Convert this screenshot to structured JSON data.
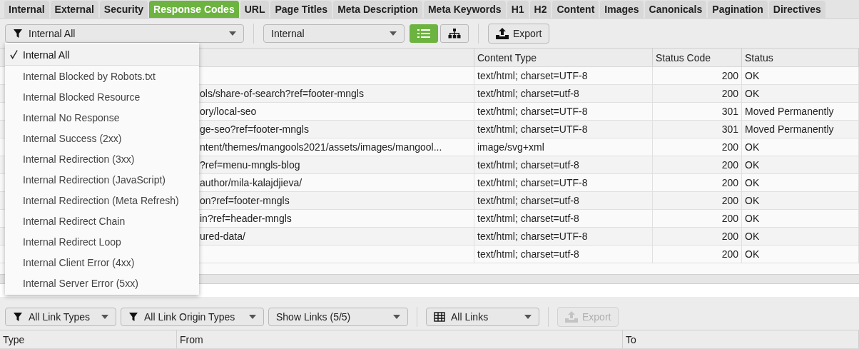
{
  "tabs": [
    {
      "label": "Internal",
      "selected": false
    },
    {
      "label": "External",
      "selected": false
    },
    {
      "label": "Security",
      "selected": false
    },
    {
      "label": "Response Codes",
      "selected": true
    },
    {
      "label": "URL",
      "selected": false
    },
    {
      "label": "Page Titles",
      "selected": false
    },
    {
      "label": "Meta Description",
      "selected": false
    },
    {
      "label": "Meta Keywords",
      "selected": false
    },
    {
      "label": "H1",
      "selected": false
    },
    {
      "label": "H2",
      "selected": false
    },
    {
      "label": "Content",
      "selected": false
    },
    {
      "label": "Images",
      "selected": false
    },
    {
      "label": "Canonicals",
      "selected": false
    },
    {
      "label": "Pagination",
      "selected": false
    },
    {
      "label": "Directives",
      "selected": false
    }
  ],
  "filter": {
    "value": "Internal All",
    "menu": [
      {
        "label": "Internal All",
        "selected": true
      },
      {
        "label": "Internal Blocked by Robots.txt",
        "selected": false
      },
      {
        "label": "Internal Blocked Resource",
        "selected": false
      },
      {
        "label": "Internal No Response",
        "selected": false
      },
      {
        "label": "Internal Success (2xx)",
        "selected": false
      },
      {
        "label": "Internal Redirection (3xx)",
        "selected": false
      },
      {
        "label": "Internal Redirection (JavaScript)",
        "selected": false
      },
      {
        "label": "Internal Redirection (Meta Refresh)",
        "selected": false
      },
      {
        "label": "Internal Redirect Chain",
        "selected": false
      },
      {
        "label": "Internal Redirect Loop",
        "selected": false
      },
      {
        "label": "Internal Client Error (4xx)",
        "selected": false
      },
      {
        "label": "Internal Server Error (5xx)",
        "selected": false
      }
    ]
  },
  "scope": {
    "value": "Internal"
  },
  "view_toggle": [
    {
      "kind": "list",
      "selected": true
    },
    {
      "kind": "tree",
      "selected": false
    }
  ],
  "export": {
    "label": "Export",
    "disabled": false
  },
  "table": {
    "columns": [
      "Content Type",
      "Status Code",
      "Status"
    ],
    "rows": [
      {
        "content_type": "text/html; charset=UTF-8",
        "status_code": "200",
        "status": "OK"
      },
      {
        "address": "ols/share-of-search?ref=footer-mngls",
        "content_type": "text/html; charset=utf-8",
        "status_code": "200",
        "status": "OK"
      },
      {
        "address": "ory/local-seo",
        "content_type": "text/html; charset=UTF-8",
        "status_code": "301",
        "status": "Moved Permanently"
      },
      {
        "address": "ge-seo?ref=footer-mngls",
        "content_type": "text/html; charset=UTF-8",
        "status_code": "301",
        "status": "Moved Permanently"
      },
      {
        "address": "ntent/themes/mangools2021/assets/images/mangool...",
        "content_type": "image/svg+xml",
        "status_code": "200",
        "status": "OK"
      },
      {
        "address": "?ref=menu-mngls-blog",
        "content_type": "text/html; charset=utf-8",
        "status_code": "200",
        "status": "OK"
      },
      {
        "address": "author/mila-kalajdjieva/",
        "content_type": "text/html; charset=UTF-8",
        "status_code": "200",
        "status": "OK"
      },
      {
        "address": "on?ref=footer-mngls",
        "content_type": "text/html; charset=utf-8",
        "status_code": "200",
        "status": "OK"
      },
      {
        "address": "in?ref=header-mngls",
        "content_type": "text/html; charset=utf-8",
        "status_code": "200",
        "status": "OK"
      },
      {
        "address": "ured-data/",
        "content_type": "text/html; charset=UTF-8",
        "status_code": "200",
        "status": "OK"
      },
      {
        "content_type": "text/html; charset=utf-8",
        "status_code": "200",
        "status": "OK"
      }
    ]
  },
  "link_filters": [
    {
      "kind": "filter",
      "label": "All Link Types"
    },
    {
      "kind": "filter",
      "label": "All Link Origin Types"
    },
    {
      "kind": "plain",
      "label": "Show Links (5/5)"
    },
    {
      "kind": "grid",
      "label": "All Links"
    }
  ],
  "link_export": {
    "label": "Export",
    "disabled": true
  },
  "links_table": {
    "columns": [
      "Type",
      "From",
      "To"
    ]
  }
}
